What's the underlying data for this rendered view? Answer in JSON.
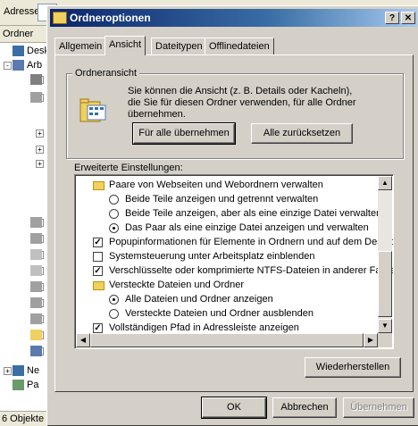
{
  "explorer": {
    "address_label": "Adresse",
    "folders_label": "Ordner",
    "tree": [
      {
        "label": "Deskto",
        "expander": "",
        "icon": "desktop-icon"
      },
      {
        "label": "Arb",
        "expander": "-",
        "icon": "computer-icon"
      },
      {
        "label": "",
        "expander": "+",
        "icon": "floppy-icon"
      },
      {
        "label": "",
        "expander": "-",
        "icon": "drive-icon"
      },
      {
        "label": "",
        "expander": "",
        "icon": ""
      },
      {
        "label": "",
        "expander": "",
        "icon": ""
      },
      {
        "label": "",
        "expander": "+",
        "icon": ""
      },
      {
        "label": "",
        "expander": "+",
        "icon": ""
      },
      {
        "label": "",
        "expander": "+",
        "icon": ""
      },
      {
        "label": "",
        "expander": "",
        "icon": ""
      },
      {
        "label": "",
        "expander": "",
        "icon": ""
      },
      {
        "label": "",
        "expander": "+",
        "icon": ""
      },
      {
        "label": "",
        "expander": "+",
        "icon": "drive-icon"
      },
      {
        "label": "",
        "expander": "+",
        "icon": "drive-icon"
      },
      {
        "label": "",
        "expander": "+",
        "icon": "cd-icon"
      },
      {
        "label": "",
        "expander": "+",
        "icon": "cd-icon"
      },
      {
        "label": "",
        "expander": "+",
        "icon": "drive-icon"
      },
      {
        "label": "",
        "expander": "+",
        "icon": "drive-icon"
      },
      {
        "label": "",
        "expander": "+",
        "icon": "drive-icon"
      },
      {
        "label": "",
        "expander": "+",
        "icon": "folder-icon"
      },
      {
        "label": "",
        "expander": "+",
        "icon": "network-drive-icon"
      },
      {
        "label": "Ne",
        "expander": "+",
        "icon": "network-icon"
      },
      {
        "label": "Pa",
        "expander": "",
        "icon": "recycle-icon"
      }
    ],
    "status": "6 Objekte"
  },
  "dialog": {
    "title": "Ordneroptionen",
    "help_button": "?",
    "close_button": "✕",
    "tabs": [
      {
        "label": "Allgemein",
        "active": false
      },
      {
        "label": "Ansicht",
        "active": true
      },
      {
        "label": "Dateitypen",
        "active": false
      },
      {
        "label": "Offlinedateien",
        "active": false
      }
    ],
    "folder_view": {
      "group_title": "Ordneransicht",
      "description": "Sie können die Ansicht (z. B. Details oder Kacheln), die Sie für diesen Ordner verwenden, für alle Ordner übernehmen.",
      "apply_all_button": "Für alle übernehmen",
      "reset_all_button": "Alle zurücksetzen"
    },
    "advanced": {
      "label": "Erweiterte Einstellungen:",
      "items": [
        {
          "type": "folder",
          "indent": 0,
          "text": "Paare von Webseiten und Webordnern verwalten"
        },
        {
          "type": "radio",
          "checked": false,
          "indent": 1,
          "text": "Beide Teile anzeigen und getrennt verwalten"
        },
        {
          "type": "radio",
          "checked": false,
          "indent": 1,
          "text": "Beide Teile anzeigen, aber als eine einzige Datei verwalten"
        },
        {
          "type": "radio",
          "checked": true,
          "indent": 1,
          "text": "Das Paar als eine einzige Datei anzeigen und verwalten"
        },
        {
          "type": "checkbox",
          "checked": true,
          "indent": 0,
          "text": "Popupinformationen für Elemente in Ordnern und auf dem Desktop anzeigen"
        },
        {
          "type": "checkbox",
          "checked": false,
          "indent": 0,
          "text": "Systemsteuerung unter Arbeitsplatz einblenden"
        },
        {
          "type": "checkbox",
          "checked": true,
          "indent": 0,
          "text": "Verschlüsselte oder komprimierte NTFS-Dateien in anderer Farbe anzeigen"
        },
        {
          "type": "folder",
          "indent": 0,
          "text": "Versteckte Dateien und Ordner"
        },
        {
          "type": "radio",
          "checked": true,
          "indent": 1,
          "text": "Alle Dateien und Ordner anzeigen"
        },
        {
          "type": "radio",
          "checked": false,
          "indent": 1,
          "text": "Versteckte Dateien und Ordner ausblenden"
        },
        {
          "type": "checkbox",
          "checked": true,
          "indent": 0,
          "text": "Vollständigen Pfad in Adressleiste anzeigen"
        }
      ],
      "vscroll_up": "▲",
      "vscroll_down": "▼",
      "hscroll_left": "◀",
      "hscroll_right": "▶"
    },
    "restore_button": "Wiederherstellen",
    "ok_button": "OK",
    "cancel_button": "Abbrechen",
    "apply_button": "Übernehmen"
  }
}
